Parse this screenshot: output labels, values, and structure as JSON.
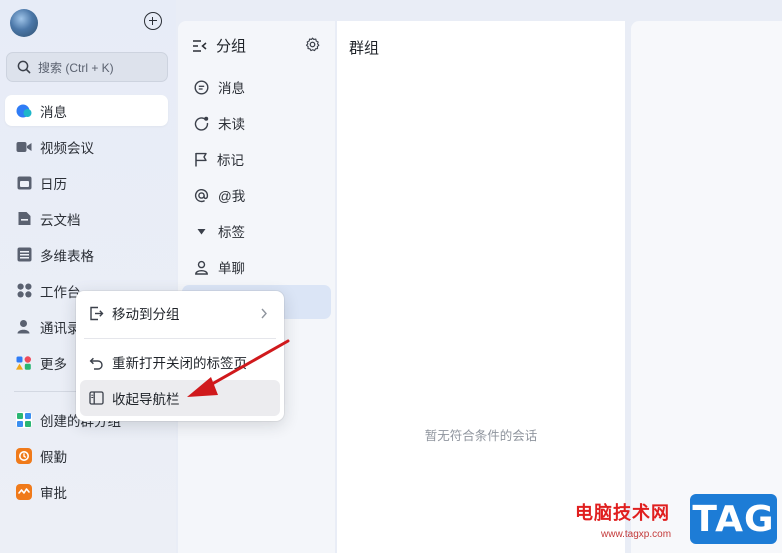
{
  "nav": {
    "search_placeholder": "搜索 (Ctrl + K)",
    "items": [
      {
        "label": "消息",
        "icon": "message-icon"
      },
      {
        "label": "视频会议",
        "icon": "video-icon"
      },
      {
        "label": "日历",
        "icon": "calendar-icon"
      },
      {
        "label": "云文档",
        "icon": "cloud-doc-icon"
      },
      {
        "label": "多维表格",
        "icon": "table-icon"
      },
      {
        "label": "工作台",
        "icon": "workspace-icon"
      },
      {
        "label": "通讯录",
        "icon": "contacts-icon"
      },
      {
        "label": "更多",
        "icon": "more-icon"
      }
    ],
    "apps": [
      {
        "label": "创建的群分组",
        "icon": "group-app-icon",
        "color": "#3a8ef0"
      },
      {
        "label": "假勤",
        "icon": "leave-icon",
        "color": "#f07a1a"
      },
      {
        "label": "审批",
        "icon": "approval-icon",
        "color": "#f07a1a"
      }
    ]
  },
  "groups": {
    "title": "分组",
    "items": [
      {
        "label": "消息",
        "icon": "chat-bubble-icon"
      },
      {
        "label": "未读",
        "icon": "unread-icon"
      },
      {
        "label": "标记",
        "icon": "flag-icon"
      },
      {
        "label": "@我",
        "icon": "at-icon"
      },
      {
        "label": "标签",
        "icon": "tag-arrow-icon"
      },
      {
        "label": "单聊",
        "icon": "person-icon"
      }
    ]
  },
  "chatlist": {
    "title": "群组",
    "empty_text": "暂无符合条件的会话"
  },
  "context_menu": {
    "items": [
      {
        "label": "移动到分组"
      },
      {
        "label": "重新打开关闭的标签页"
      },
      {
        "label": "收起导航栏"
      }
    ]
  },
  "watermark": {
    "text": "电脑技术网",
    "url": "www.tagxp.com",
    "badge": "TAG"
  },
  "colors": {
    "accent": "#3370ff",
    "arrow": "#d0191c"
  }
}
